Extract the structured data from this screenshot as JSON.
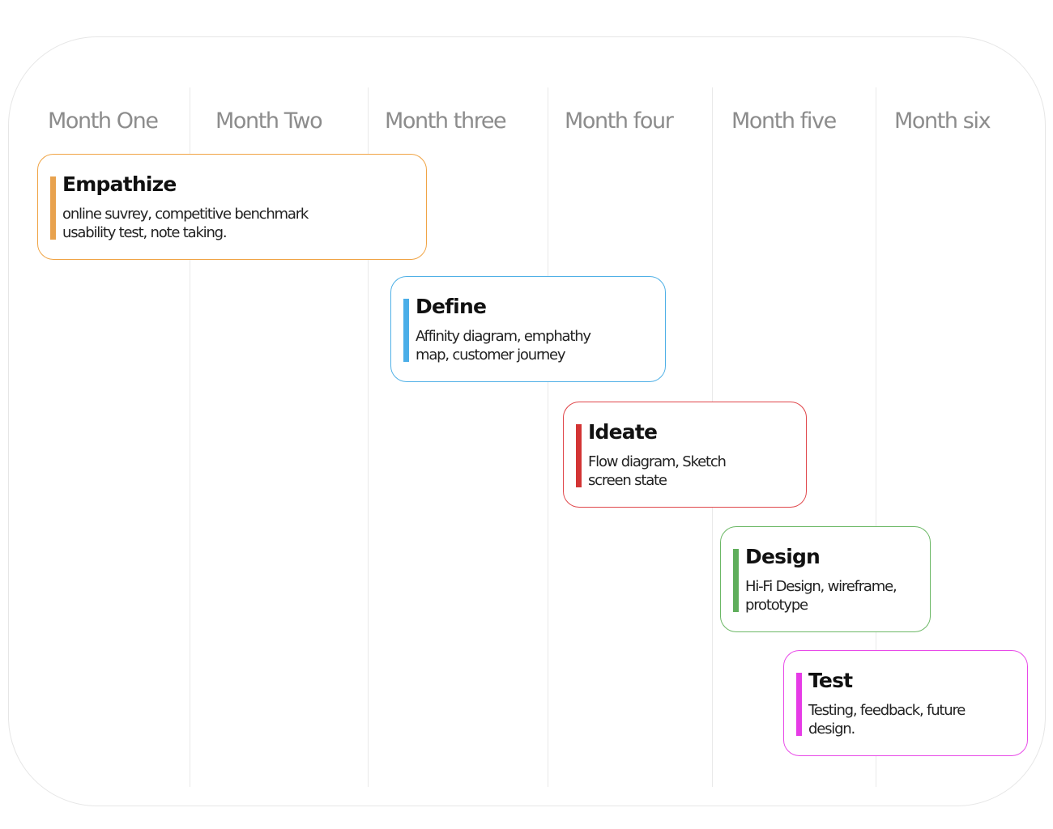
{
  "months": [
    "Month One",
    "Month Two",
    "Month three",
    "Month four",
    "Month five",
    "Month six"
  ],
  "phases": [
    {
      "title": "Empathize",
      "description": "online suvrey, competitive benchmark\nusability test, note taking.",
      "color": "#f0a445",
      "bar_color": "#e8a24e"
    },
    {
      "title": "Define",
      "description": "Affinity diagram, emphathy\nmap, customer journey",
      "color": "#4fb0e6",
      "bar_color": "#4aaee8"
    },
    {
      "title": "Ideate",
      "description": "Flow diagram, Sketch\nscreen state",
      "color": "#e0474b",
      "bar_color": "#d33434"
    },
    {
      "title": "Design",
      "description": "Hi-Fi Design, wireframe,\nprototype",
      "color": "#6cb866",
      "bar_color": "#5fae5b"
    },
    {
      "title": "Test",
      "description": "Testing, feedback, future\ndesign.",
      "color": "#e84ae8",
      "bar_color": "#e63be6"
    }
  ]
}
